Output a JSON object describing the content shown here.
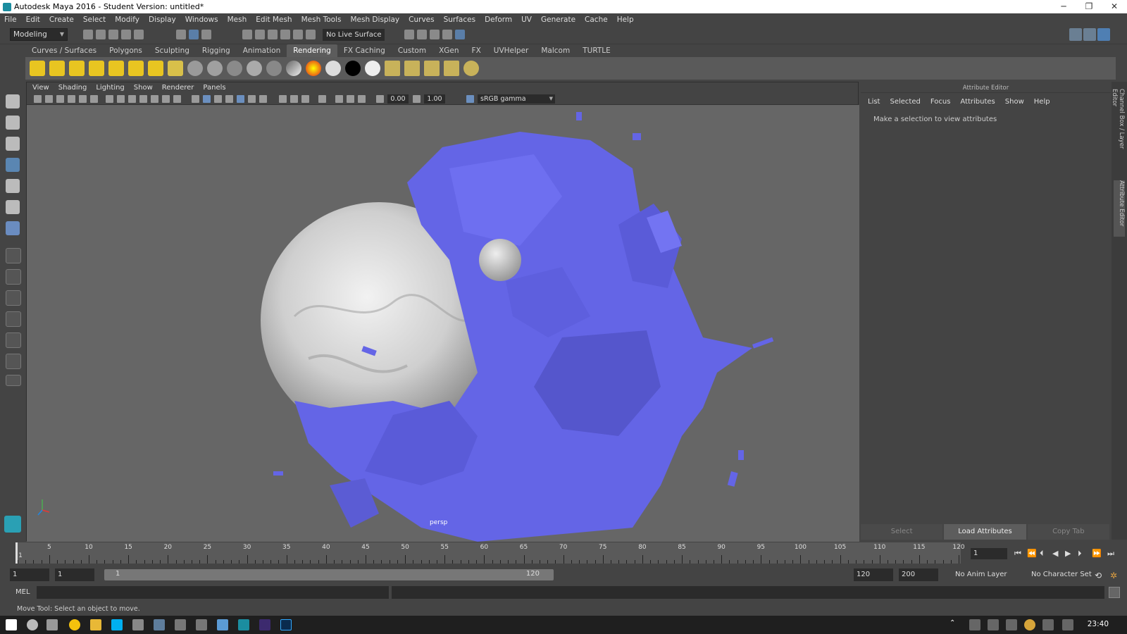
{
  "window": {
    "title": "Autodesk Maya 2016 - Student Version: untitled*",
    "controls": [
      "─",
      "❐",
      "✕"
    ]
  },
  "menubar": [
    "File",
    "Edit",
    "Create",
    "Select",
    "Modify",
    "Display",
    "Windows",
    "Mesh",
    "Edit Mesh",
    "Mesh Tools",
    "Mesh Display",
    "Curves",
    "Surfaces",
    "Deform",
    "UV",
    "Generate",
    "Cache",
    "Help"
  ],
  "statusline": {
    "mode": "Modeling",
    "live_surface": "No Live Surface"
  },
  "shelf": {
    "tabs": [
      "Curves / Surfaces",
      "Polygons",
      "Sculpting",
      "Rigging",
      "Animation",
      "Rendering",
      "FX Caching",
      "Custom",
      "XGen",
      "FX",
      "UVHelper",
      "Malcom",
      "TURTLE"
    ],
    "active_tab": "Rendering"
  },
  "viewport": {
    "menu": [
      "View",
      "Shading",
      "Lighting",
      "Show",
      "Renderer",
      "Panels"
    ],
    "exposure": "0.00",
    "gamma_value": "1.00",
    "color_space": "sRGB gamma",
    "camera_label": "persp"
  },
  "attribute_editor": {
    "header": "Attribute Editor",
    "menu": [
      "List",
      "Selected",
      "Focus",
      "Attributes",
      "Show",
      "Help"
    ],
    "message": "Make a selection to view attributes",
    "buttons": [
      "Select",
      "Load Attributes",
      "Copy Tab"
    ]
  },
  "side_tabs": [
    "Channel Box / Layer Editor",
    "Attribute Editor"
  ],
  "time_slider": {
    "labels": [
      "1",
      "5",
      "10",
      "15",
      "20",
      "25",
      "30",
      "35",
      "40",
      "45",
      "50",
      "55",
      "60",
      "65",
      "70",
      "75",
      "80",
      "85",
      "90",
      "95",
      "100",
      "105",
      "110",
      "115",
      "120"
    ],
    "current_frame": "1"
  },
  "range_slider": {
    "start": "1",
    "playback_start": "1",
    "slider_start": "1",
    "slider_end": "120",
    "playback_end": "120",
    "end": "200",
    "anim_layer": "No Anim Layer",
    "character_set": "No Character Set"
  },
  "command_line": {
    "language": "MEL"
  },
  "help_line": "Move Tool: Select an object to move.",
  "taskbar": {
    "clock": "23:40"
  }
}
